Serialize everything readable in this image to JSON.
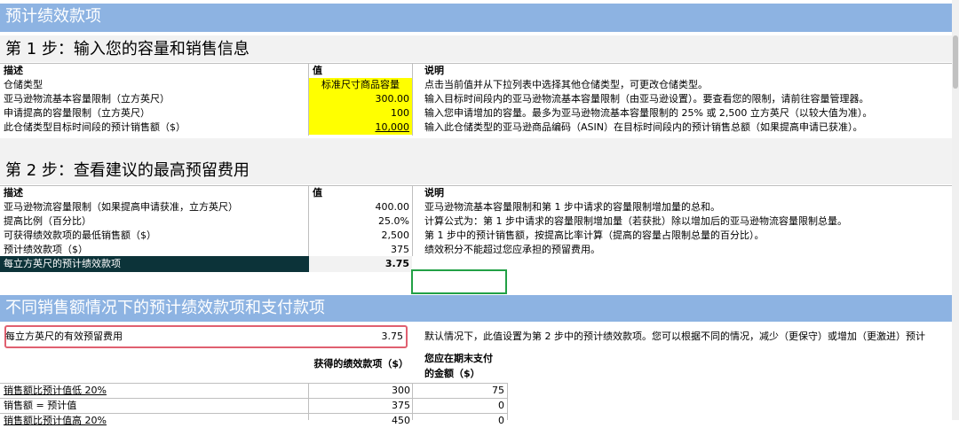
{
  "banner1": "预计绩效款项",
  "step1": {
    "title": "第 1 步：输入您的容量和销售信息",
    "headers": [
      "描述",
      "值",
      "说明"
    ],
    "rows": [
      {
        "desc": "仓储类型",
        "val": "标准尺寸商品容量",
        "note": "点击当前值并从下拉列表中选择其他仓储类型，可更改仓储类型。"
      },
      {
        "desc": "亚马逊物流基本容量限制（立方英尺）",
        "val": "300.00",
        "note": "输入目标时间段内的亚马逊物流基本容量限制（由亚马逊设置）。要查看您的限制，请前往容量管理器。"
      },
      {
        "desc": "申请提高的容量限制（立方英尺）",
        "val": "100",
        "note": "输入您申请增加的容量。最多为亚马逊物流基本容量限制的 25% 或 2,500 立方英尺（以较大值为准）。"
      },
      {
        "desc": "此仓储类型目标时间段的预计销售额（$）",
        "val": "10,000",
        "note": "输入此仓储类型的亚马逊商品编码（ASIN）在目标时间段内的预计销售总额（如果提高申请已获准）。"
      }
    ]
  },
  "step2": {
    "title": "第 2 步：查看建议的最高预留费用",
    "headers": [
      "描述",
      "值",
      "说明"
    ],
    "rows": [
      {
        "desc": "亚马逊物流容量限制（如果提高申请获准，立方英尺）",
        "val": "400.00",
        "note": "亚马逊物流基本容量限制和第 1 步中请求的容量限制增加量的总和。"
      },
      {
        "desc": "提高比例（百分比）",
        "val": "25.0%",
        "note": "计算公式为：第 1 步中请求的容量限制增加量（若获批）除以增加后的亚马逊物流容量限制总量。"
      },
      {
        "desc": "可获得绩效款项的最低销售额（$）",
        "val": "2,500",
        "note": "第 1 步中的预计销售额，按提高比率计算（提高的容量占限制总量的百分比）。"
      },
      {
        "desc": "预计绩效款项（$）",
        "val": "375",
        "note": "绩效积分不能超过您应承担的预留费用。"
      },
      {
        "desc": "每立方英尺的预计绩效款项",
        "val": "3.75",
        "note": ""
      }
    ]
  },
  "banner2": "不同销售额情况下的预计绩效款项和支付款项",
  "section3": {
    "eff_label": "每立方英尺的有效预留费用",
    "eff_value": "3.75",
    "eff_note": "默认情况下，此值设置为第 2 步中的预计绩效款项。您可以根据不同的情况，减少（更保守）或增加（更激进）预计",
    "col_a": "获得的绩效款项（$）",
    "col_b_line1": "您应在期末支付",
    "col_b_line2": "的金额（$）",
    "rows": [
      {
        "label": "销售额比预计值低 20%",
        "a": "300",
        "b": "75"
      },
      {
        "label": "销售额 = 预计值",
        "a": "375",
        "b": "0"
      },
      {
        "label": "销售额比预计值高 20%",
        "a": "450",
        "b": "0"
      }
    ]
  },
  "colors": {
    "banner": "#8db3e2",
    "input": "#ffff00",
    "dark_row": "#0c3339",
    "highlight_box": "#e06070",
    "selected_cell": "#22a045"
  }
}
